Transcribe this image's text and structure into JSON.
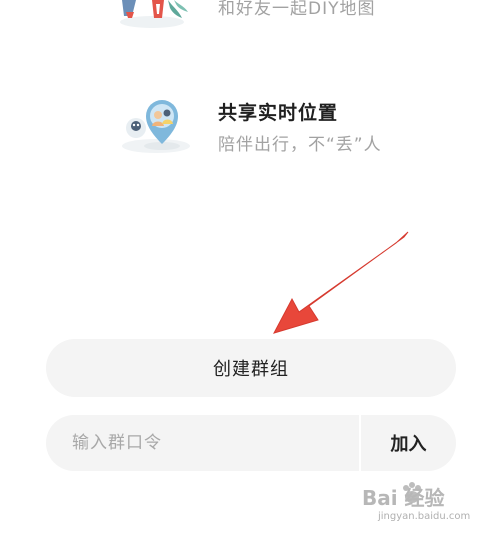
{
  "features": [
    {
      "title": "",
      "subtitle": "和好友一起DIY地图",
      "illustration": "diy-map-illustration"
    },
    {
      "title": "共享实时位置",
      "subtitle": "陪伴出行，不“丢”人",
      "illustration": "share-location-illustration"
    }
  ],
  "actions": {
    "create_group_label": "创建群组",
    "join_placeholder": "输入群口令",
    "join_value": "",
    "join_button_label": "加入"
  },
  "annotation": {
    "arrow_icon": "red-arrow-pointer",
    "color": "#e8473a"
  },
  "watermark": {
    "brand": "Bai 经验",
    "url": "jingyan.baidu.com"
  },
  "colors": {
    "button_bg": "#f4f4f4",
    "title": "#1f1f1f",
    "subtitle": "#a2a2a2"
  }
}
